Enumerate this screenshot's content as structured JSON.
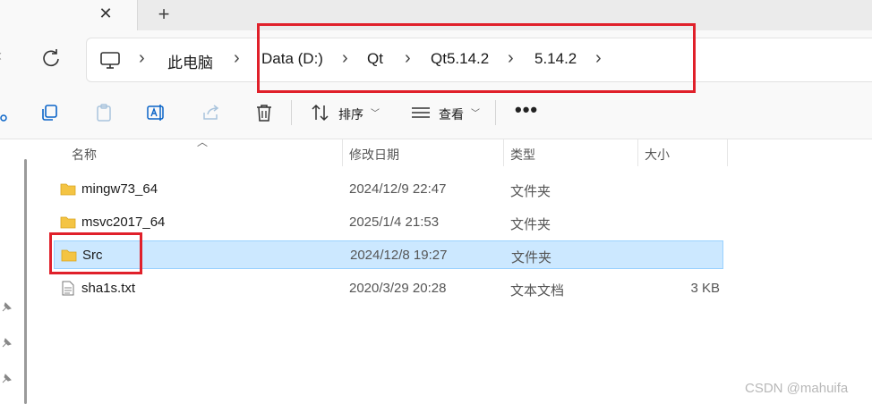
{
  "tabs": {
    "close_glyph": "✕",
    "new_glyph": "+"
  },
  "nav": {
    "back_glyph": "‹",
    "breadcrumbs": [
      "此电脑",
      "Data (D:)",
      "Qt",
      "Qt5.14.2",
      "5.14.2"
    ],
    "separator": "›"
  },
  "toolbar": {
    "sort_label": "排序",
    "view_label": "查看",
    "more_label": "•••"
  },
  "columns": {
    "name": "名称",
    "modified": "修改日期",
    "type": "类型",
    "size": "大小"
  },
  "files": [
    {
      "name": "mingw73_64",
      "date": "2024/12/9 22:47",
      "type": "文件夹",
      "size": "",
      "icon": "folder-icon",
      "selected": false
    },
    {
      "name": "msvc2017_64",
      "date": "2025/1/4 21:53",
      "type": "文件夹",
      "size": "",
      "icon": "folder-icon",
      "selected": false
    },
    {
      "name": "Src",
      "date": "2024/12/8 19:27",
      "type": "文件夹",
      "size": "",
      "icon": "folder-icon",
      "selected": true
    },
    {
      "name": "sha1s.txt",
      "date": "2020/3/29 20:28",
      "type": "文本文档",
      "size": "3 KB",
      "icon": "text-file-icon",
      "selected": false
    }
  ],
  "watermark": "CSDN @mahuifa",
  "colors": {
    "selection": "#cce8ff",
    "annotation": "#e0202a",
    "folder": "#f4c443"
  }
}
